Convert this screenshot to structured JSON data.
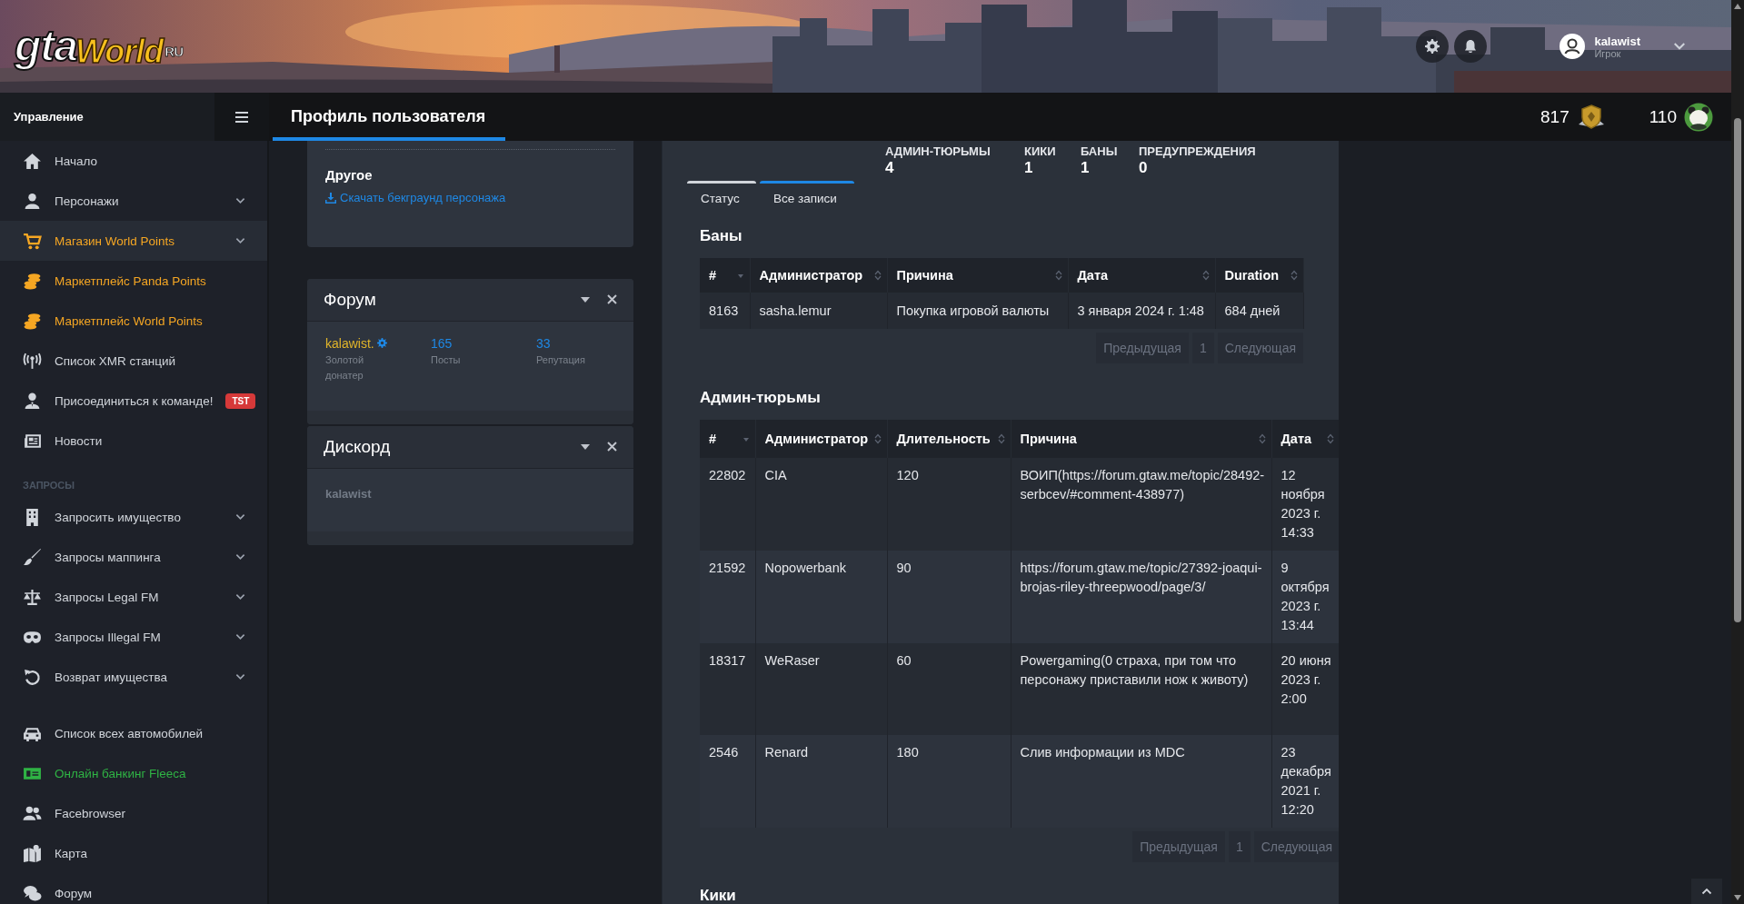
{
  "header": {
    "logo": {
      "main": "gta",
      "accent": "World",
      "suffix": "RU"
    },
    "user": {
      "name": "kalawist",
      "role": "Игрок"
    }
  },
  "topbar": {
    "sidebar_title": "Управление",
    "page_title": "Профиль пользователя",
    "points": [
      {
        "kind": "badge",
        "value": "817"
      },
      {
        "kind": "panda",
        "value": "110"
      }
    ]
  },
  "sidebar": {
    "groups": [
      {
        "items": [
          {
            "label": "Начало",
            "color": "#d1d5db",
            "expandable": false,
            "selected": false
          },
          {
            "label": "Персонажи",
            "color": "#d1d5db",
            "expandable": true,
            "selected": false
          },
          {
            "label": "Магазин World Points",
            "color": "#f5a623",
            "expandable": true,
            "selected": true
          },
          {
            "label": "Маркетплейс Panda Points",
            "color": "#f5a623",
            "expandable": false,
            "selected": false
          },
          {
            "label": "Маркетплейс World Points",
            "color": "#f5a623",
            "expandable": false,
            "selected": false
          },
          {
            "label": "Список XMR станций",
            "color": "#d1d5db",
            "expandable": false,
            "selected": false
          },
          {
            "label": "Присоединиться к команде!",
            "color": "#d1d5db",
            "expandable": false,
            "selected": false,
            "badge": "TST"
          },
          {
            "label": "Новости",
            "color": "#d1d5db",
            "expandable": false,
            "selected": false
          }
        ]
      },
      {
        "title": "ЗАПРОСЫ",
        "items": [
          {
            "label": "Запросить имущество",
            "color": "#d1d5db",
            "expandable": true,
            "selected": false
          },
          {
            "label": "Запросы маппинга",
            "color": "#d1d5db",
            "expandable": true,
            "selected": false
          },
          {
            "label": "Запросы Legal FM",
            "color": "#d1d5db",
            "expandable": true,
            "selected": false
          },
          {
            "label": "Запросы Illegal FM",
            "color": "#d1d5db",
            "expandable": true,
            "selected": false
          },
          {
            "label": "Возврат имущества",
            "color": "#d1d5db",
            "expandable": true,
            "selected": false
          }
        ]
      },
      {
        "items": [
          {
            "label": "Список всех автомобилей",
            "color": "#d1d5db",
            "expandable": false,
            "selected": false
          },
          {
            "label": "Онлайн банкинг Fleeca",
            "color": "#2fb344",
            "expandable": false,
            "selected": false
          },
          {
            "label": "Facebrowser",
            "color": "#d1d5db",
            "expandable": false,
            "selected": false
          },
          {
            "label": "Карта",
            "color": "#d1d5db",
            "expandable": false,
            "selected": false
          },
          {
            "label": "Форум",
            "color": "#d1d5db",
            "expandable": false,
            "selected": false
          }
        ]
      }
    ]
  },
  "cards": {
    "other": {
      "title": "Другое",
      "link": "Скачать бекграунд персонажа"
    },
    "forum": {
      "title": "Форум",
      "user": "kalawist.",
      "rank": "Золотой донатер",
      "stats": [
        {
          "value": "165",
          "label": "Посты"
        },
        {
          "value": "33",
          "label": "Репутация"
        }
      ]
    },
    "discord": {
      "title": "Дискорд",
      "user": "kalawist"
    }
  },
  "record": {
    "stats": [
      {
        "label": "АДМИН-ТЮРЬМЫ",
        "value": "4"
      },
      {
        "label": "КИКИ",
        "value": "1"
      },
      {
        "label": "БАНЫ",
        "value": "1"
      },
      {
        "label": "ПРЕДУПРЕЖДЕНИЯ",
        "value": "0"
      }
    ],
    "tabs": [
      {
        "label": "Статус",
        "selected": false
      },
      {
        "label": "Все записи",
        "selected": true
      }
    ],
    "bans": {
      "title": "Баны",
      "columns": [
        {
          "label": "#",
          "sorted": true
        },
        {
          "label": "Администратор",
          "sorted": false
        },
        {
          "label": "Причина",
          "sorted": false
        },
        {
          "label": "Дата",
          "sorted": false
        },
        {
          "label": "Duration",
          "sorted": false
        }
      ],
      "rows": [
        [
          "8163",
          "sasha.lemur",
          "Покупка игровой валюты",
          "3 января 2024 г. 1:48",
          "684 дней"
        ]
      ],
      "pagination": {
        "prev": "Предыдущая",
        "page": "1",
        "next": "Следующая"
      }
    },
    "jails": {
      "title": "Админ-тюрьмы",
      "columns": [
        {
          "label": "#",
          "sorted": true
        },
        {
          "label": "Администратор",
          "sorted": false
        },
        {
          "label": "Длительность",
          "sorted": false
        },
        {
          "label": "Причина",
          "sorted": false
        },
        {
          "label": "Дата",
          "sorted": false
        }
      ],
      "rows": [
        [
          "22802",
          "CIA",
          "120",
          "ВОИП(https://forum.gtaw.me/topic/28492-serbcev/#comment-438977)",
          "12 ноября 2023 г. 14:33"
        ],
        [
          "21592",
          "Nopowerbank",
          "90",
          "https://forum.gtaw.me/topic/27392-joaqui-brojas-riley-threepwood/page/3/",
          "9 октября 2023 г. 13:44"
        ],
        [
          "18317",
          "WeRaser",
          "60",
          "Powergaming(0 страха, при том что персонажу приставили нож к животу)",
          "20 июня 2023 г. 2:00"
        ],
        [
          "2546",
          "Renard",
          "180",
          "Слив информации из MDC",
          "23 декабря 2021 г. 12:20"
        ]
      ],
      "pagination": {
        "prev": "Предыдущая",
        "page": "1",
        "next": "Следующая"
      }
    },
    "kicks": {
      "title": "Кики"
    }
  }
}
